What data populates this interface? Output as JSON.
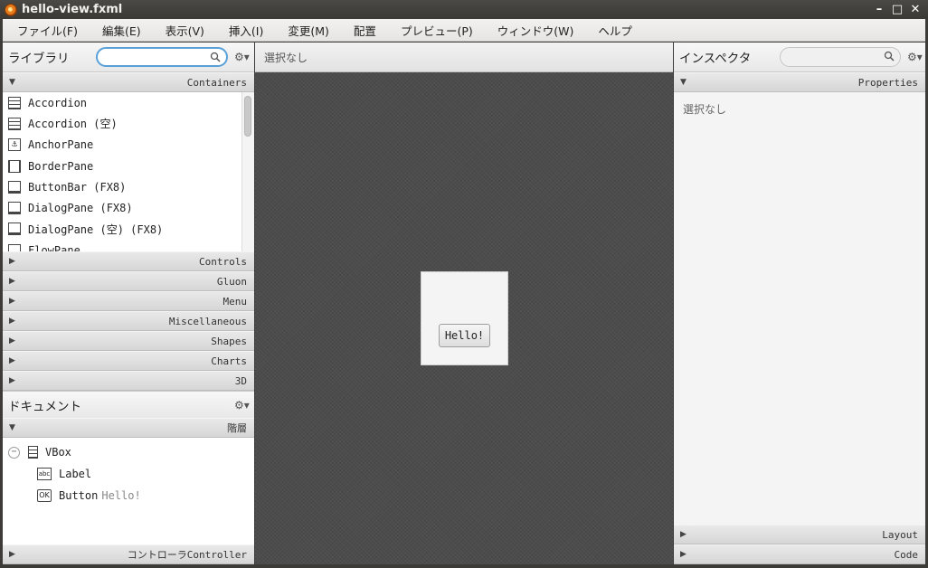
{
  "window": {
    "title": "hello-view.fxml"
  },
  "menu": [
    "ファイル(F)",
    "編集(E)",
    "表示(V)",
    "挿入(I)",
    "変更(M)",
    "配置",
    "プレビュー(P)",
    "ウィンドウ(W)",
    "ヘルプ"
  ],
  "library": {
    "title": "ライブラリ",
    "search_value": "",
    "sections": {
      "containers": "Containers",
      "controls": "Controls",
      "gluon": "Gluon",
      "menu": "Menu",
      "misc": "Miscellaneous",
      "shapes": "Shapes",
      "charts": "Charts",
      "threed": "3D"
    },
    "items": [
      "Accordion",
      "Accordion (空)",
      "AnchorPane",
      "BorderPane",
      "ButtonBar (FX8)",
      "DialogPane (FX8)",
      "DialogPane (空) (FX8)",
      "FlowPane"
    ]
  },
  "document": {
    "title": "ドキュメント",
    "hierarchy_label": "階層",
    "tree": {
      "root": "VBox",
      "child1": "Label",
      "child2": "Button",
      "child2_text": "Hello!"
    },
    "controller_label": "コントローラController"
  },
  "canvas": {
    "selection_text": "選択なし",
    "button_label": "Hello!"
  },
  "inspector": {
    "title": "インスペクタ",
    "properties_label": "Properties",
    "empty_text": "選択なし",
    "layout_label": "Layout",
    "code_label": "Code"
  }
}
